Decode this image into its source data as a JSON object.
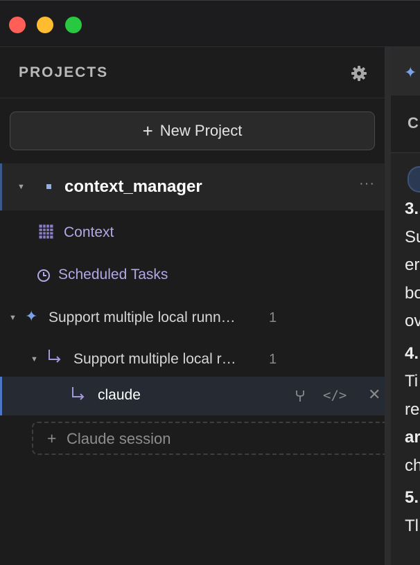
{
  "sidebar": {
    "title": "PROJECTS",
    "new_project_label": "New Project",
    "project": {
      "name": "context_manager"
    },
    "context_label": "Context",
    "scheduled_label": "Scheduled Tasks",
    "tasks": [
      {
        "label": "Support multiple local runn…",
        "count": "1"
      },
      {
        "label": "Support multiple local r…",
        "count": "1"
      }
    ],
    "session": {
      "label": "claude"
    },
    "claude_session_label": "Claude session"
  },
  "main": {
    "tab_letter": "C",
    "doc_lines": [
      "3.",
      "Su",
      "er",
      "bo",
      "ov",
      "4.",
      "Ti",
      "re",
      "ar",
      "ch",
      "5.",
      "Tl"
    ]
  },
  "icons": [
    "gear-icon",
    "plus-icon",
    "caret-down-icon",
    "project-dot-icon",
    "more-icon",
    "grid-icon",
    "clock-icon",
    "sparkle-icon",
    "branch-icon",
    "fork-icon",
    "code-icon",
    "close-icon"
  ],
  "colors": {
    "accent": "#4a78c7",
    "link_purple": "#b4a7e6",
    "sparkle_blue": "#7aa2e8",
    "background": "#1c1c1c"
  }
}
